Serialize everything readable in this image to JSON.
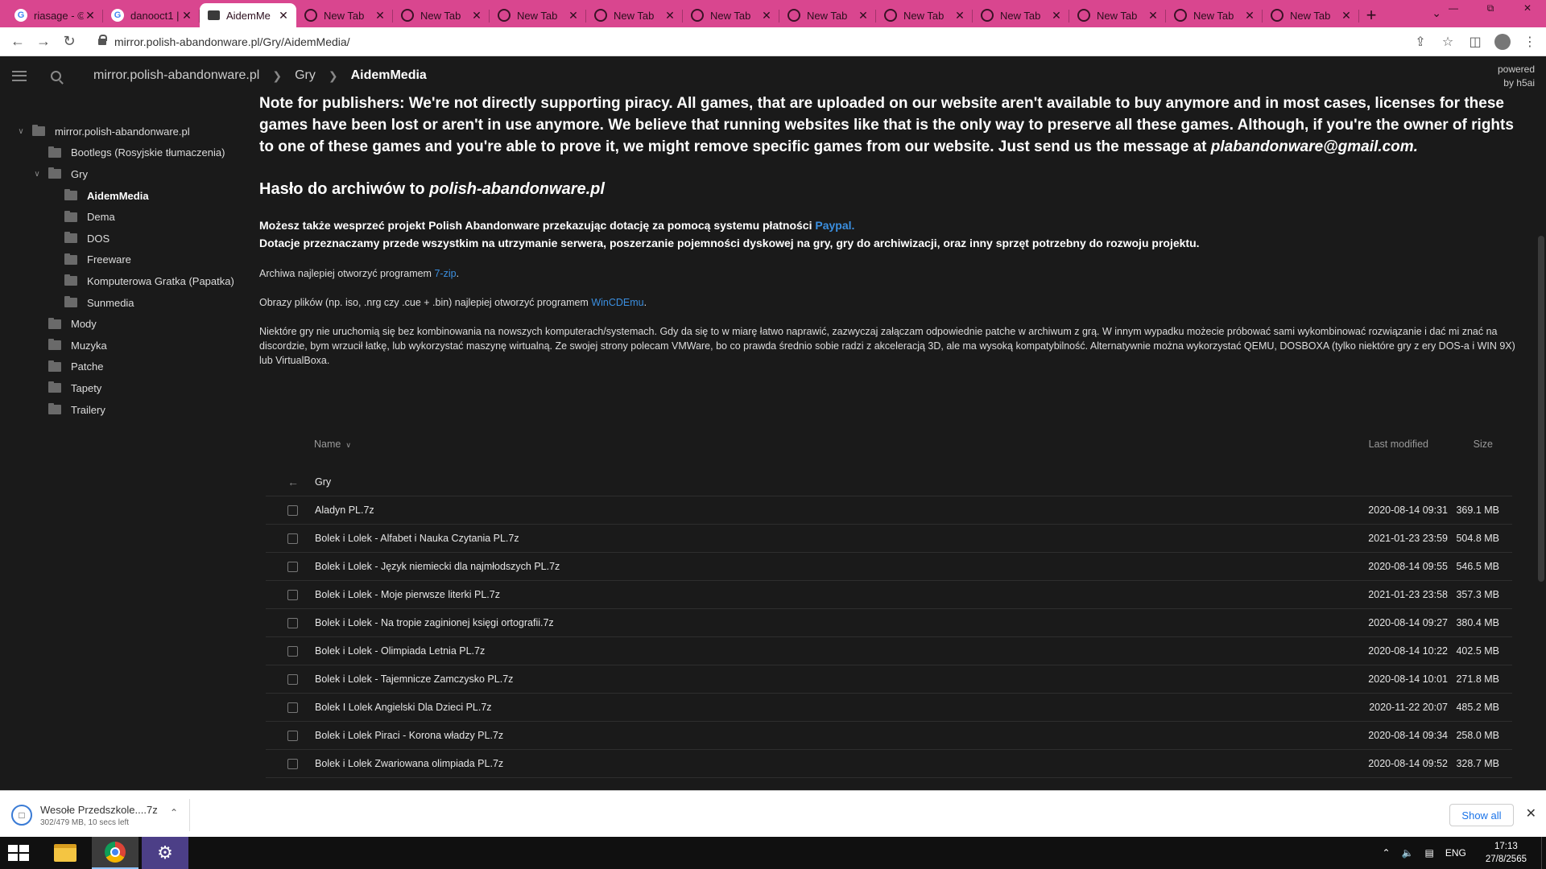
{
  "browser": {
    "tabs": [
      {
        "title": "riasage - ©",
        "icon": "google-icon",
        "active": false
      },
      {
        "title": "danooct1 |",
        "icon": "google-icon",
        "active": false
      },
      {
        "title": "AidemMe",
        "icon": "folder-icon",
        "active": true
      },
      {
        "title": "New Tab",
        "icon": "globe-icon",
        "active": false
      },
      {
        "title": "New Tab",
        "icon": "globe-icon",
        "active": false
      },
      {
        "title": "New Tab",
        "icon": "globe-icon",
        "active": false
      },
      {
        "title": "New Tab",
        "icon": "globe-icon",
        "active": false
      },
      {
        "title": "New Tab",
        "icon": "globe-icon",
        "active": false
      },
      {
        "title": "New Tab",
        "icon": "globe-icon",
        "active": false
      },
      {
        "title": "New Tab",
        "icon": "globe-icon",
        "active": false
      },
      {
        "title": "New Tab",
        "icon": "globe-icon",
        "active": false
      },
      {
        "title": "New Tab",
        "icon": "globe-icon",
        "active": false
      },
      {
        "title": "New Tab",
        "icon": "globe-icon",
        "active": false
      },
      {
        "title": "New Tab",
        "icon": "globe-icon",
        "active": false
      }
    ],
    "url": "mirror.polish-abandonware.pl/Gry/AidemMedia/",
    "tabstrip_color": "#d9468f"
  },
  "header": {
    "crumb_root": "mirror.polish-abandonware.pl",
    "crumb_1": "Gry",
    "crumb_current": "AidemMedia",
    "powered_1": "powered",
    "powered_2": "by h5ai"
  },
  "sidebar": {
    "items": [
      {
        "label": "mirror.polish-abandonware.pl",
        "chev": "∨"
      },
      {
        "label": "Bootlegs (Rosyjskie tłumaczenia)",
        "chev": ""
      },
      {
        "label": "Gry",
        "chev": "∨"
      },
      {
        "label": "AidemMedia",
        "chev": ""
      },
      {
        "label": "Dema",
        "chev": ""
      },
      {
        "label": "DOS",
        "chev": ""
      },
      {
        "label": "Freeware",
        "chev": ""
      },
      {
        "label": "Komputerowa Gratka (Papatka)",
        "chev": ""
      },
      {
        "label": "Sunmedia",
        "chev": ""
      },
      {
        "label": "Mody",
        "chev": ""
      },
      {
        "label": "Muzyka",
        "chev": ""
      },
      {
        "label": "Patche",
        "chev": ""
      },
      {
        "label": "Tapety",
        "chev": ""
      },
      {
        "label": "Trailery",
        "chev": ""
      }
    ]
  },
  "main": {
    "publisher_note": "Note for publishers: We're not directly supporting piracy. All games, that are uploaded on our website aren't available to buy anymore and in most cases, licenses for these games have been lost or aren't in use anymore. We believe that running websites like that is the only way to preserve all these games. Although, if you're the owner of rights to one of these games and you're able to prove it, we might remove specific games from our website. Just send us the message at",
    "publisher_email": "plabandonware@gmail.com.",
    "password_prefix": "Hasło do archiwów to",
    "password_value": "polish-abandonware.pl",
    "donate_1": "Możesz także wesprzeć projekt Polish Abandonware przekazując dotację za pomocą systemu płatności",
    "donate_link": "Paypal.",
    "donate_2": "Dotacje przeznaczamy przede wszystkim na utrzymanie serwera, poszerzanie pojemności dyskowej na gry, gry do archiwizacji, oraz inny sprzęt potrzebny do rozwoju projektu.",
    "archives_text": "Archiwa najlepiej otworzyć programem",
    "archives_link": "7-zip",
    "archives_end": ".",
    "images_text": "Obrazy plików (np. iso, .nrg czy .cue + .bin) najlepiej otworzyć programem",
    "images_link": "WinCDEmu",
    "images_end": ".",
    "compat_text": "Niektóre gry nie uruchomią się bez kombinowania na nowszych komputerach/systemach. Gdy da się to w miarę łatwo naprawić, zazwyczaj załączam odpowiednie patche w archiwum z grą. W innym wypadku możecie próbować sami wykombinować rozwiązanie i dać mi znać na discordzie, bym wrzucił łatkę, lub wykorzystać maszynę wirtualną. Ze swojej strony polecam VMWare, bo co prawda średnio sobie radzi z akceleracją 3D, ale ma wysoką kompatybilność. Alternatywnie można wykorzystać QEMU, DOSBOXA (tylko niektóre gry z ery DOS-a i WIN 9X) lub VirtualBoxa.",
    "link_color": "#3b8fe0"
  },
  "table": {
    "col_name": "Name",
    "col_modified": "Last modified",
    "col_size": "Size",
    "parent": "Gry",
    "rows": [
      {
        "name": "Aladyn PL.7z",
        "modified": "2020-08-14 09:31",
        "size": "369.1 MB"
      },
      {
        "name": "Bolek i Lolek - Alfabet i Nauka Czytania PL.7z",
        "modified": "2021-01-23 23:59",
        "size": "504.8 MB"
      },
      {
        "name": "Bolek i Lolek - Język niemiecki dla najmłodszych PL.7z",
        "modified": "2020-08-14 09:55",
        "size": "546.5 MB"
      },
      {
        "name": "Bolek i Lolek - Moje pierwsze literki PL.7z",
        "modified": "2021-01-23 23:58",
        "size": "357.3 MB"
      },
      {
        "name": "Bolek i Lolek - Na tropie zaginionej księgi ortografii.7z",
        "modified": "2020-08-14 09:27",
        "size": "380.4 MB"
      },
      {
        "name": "Bolek i Lolek - Olimpiada Letnia PL.7z",
        "modified": "2020-08-14 10:22",
        "size": "402.5 MB"
      },
      {
        "name": "Bolek i Lolek - Tajemnicze Zamczysko PL.7z",
        "modified": "2020-08-14 10:01",
        "size": "271.8 MB"
      },
      {
        "name": "Bolek I Lolek Angielski Dla Dzieci PL.7z",
        "modified": "2020-11-22 20:07",
        "size": "485.2 MB"
      },
      {
        "name": "Bolek i Lolek Piraci - Korona władzy PL.7z",
        "modified": "2020-08-14 09:34",
        "size": "258.0 MB"
      },
      {
        "name": "Bolek i Lolek Zwariowana olimpiada PL.7z",
        "modified": "2020-08-14 09:52",
        "size": "328.7 MB"
      }
    ]
  },
  "download": {
    "filename": "Wesołe Przedszkole....7z",
    "status": "302/479 MB, 10 secs left",
    "show_all": "Show all"
  },
  "taskbar": {
    "lang": "ENG",
    "time": "17:13",
    "date": "27/8/2565"
  }
}
